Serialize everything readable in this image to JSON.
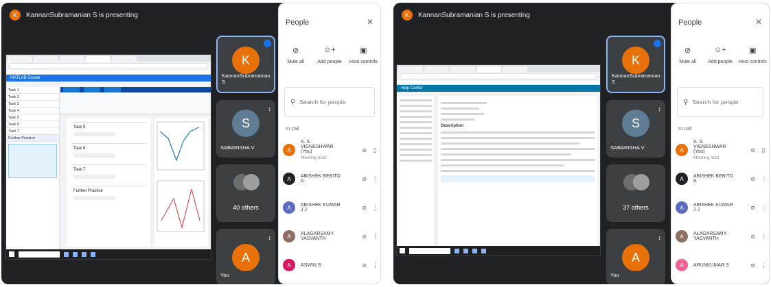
{
  "left": {
    "presenter_initial": "K",
    "presenting_text": "KannanSubramanian S is presenting",
    "matlab": {
      "app_title": "MATLAB Grader",
      "tasks": [
        "Task 1",
        "Task 2",
        "Task 3",
        "Task 4",
        "Task 5",
        "Task 6",
        "Task 7"
      ],
      "further_practice": "Further Practice",
      "editor_blocks": [
        "Task 5",
        "Task 6",
        "Task 7",
        "Further Practice"
      ]
    },
    "tiles": {
      "presenter": {
        "initial": "K",
        "name": "KannanSubramanian S"
      },
      "second": {
        "initial": "S",
        "name": "SABARISHA V"
      },
      "others": {
        "label": "40 others"
      },
      "self": {
        "initial": "A",
        "name": "You"
      }
    },
    "people": {
      "title": "People",
      "close_icon": "close-icon",
      "actions": {
        "mute_all": "Mute all",
        "add_people": "Add people",
        "host_controls": "Host controls"
      },
      "search_placeholder": "Search for people",
      "in_call": "In call",
      "participants": [
        {
          "initial": "A",
          "name": "A. S. VIGNESHWAR (You)",
          "sub": "Meeting host",
          "color": "#e8710a"
        },
        {
          "initial": "A",
          "name": "ABISHEK BEBITO A",
          "sub": "",
          "color": "#202124"
        },
        {
          "initial": "A",
          "name": "ABISHEK KUMAR J J",
          "sub": "",
          "color": "#5c6bc0"
        },
        {
          "initial": "A",
          "name": "ALAGARSAMY YASVANTH",
          "sub": "",
          "color": "#8d6e63"
        },
        {
          "initial": "A",
          "name": "ASWIN S",
          "sub": "",
          "color": "#d81b60"
        }
      ]
    }
  },
  "right": {
    "presenter_initial": "K",
    "presenting_text": "KannanSubramanian S is presenting",
    "help_center": {
      "app_title": "Help Center",
      "description": "Description"
    },
    "tiles": {
      "presenter": {
        "initial": "K",
        "name": "KannanSubramanian S"
      },
      "second": {
        "initial": "S",
        "name": "SABARISHA V"
      },
      "others": {
        "label": "37 others"
      },
      "self": {
        "initial": "A",
        "name": "You"
      }
    },
    "people": {
      "title": "People",
      "actions": {
        "mute_all": "Mute all",
        "add_people": "Add people",
        "host_controls": "Host controls"
      },
      "search_placeholder": "Search for people",
      "in_call": "In call",
      "participants": [
        {
          "initial": "A",
          "name": "A. S. VIGNESHWAR (You)",
          "sub": "Meeting host",
          "color": "#e8710a"
        },
        {
          "initial": "A",
          "name": "ABISHEK BEBITO A",
          "sub": "",
          "color": "#202124"
        },
        {
          "initial": "A",
          "name": "ABISHEK KUMAR J J",
          "sub": "",
          "color": "#5c6bc0"
        },
        {
          "initial": "A",
          "name": "ALAGARSAMY YASVANTH",
          "sub": "",
          "color": "#8d6e63"
        },
        {
          "initial": "A",
          "name": "ARUNKUMAR S",
          "sub": "",
          "color": "#f06292"
        }
      ]
    }
  },
  "colors": {
    "meet_dark": "#202124",
    "tile_bg": "#3c4043",
    "presenter_orange": "#e8710a",
    "second_blue": "#5f7d95",
    "self_orange": "#e8710a",
    "active_border": "#8ab4f8"
  }
}
